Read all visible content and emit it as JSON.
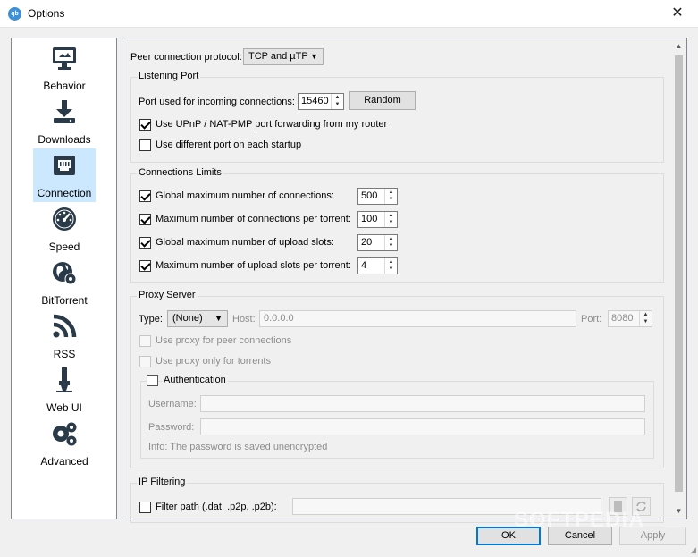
{
  "window": {
    "title": "Options",
    "app_icon": "qb",
    "close": "✕"
  },
  "sidebar": {
    "items": [
      {
        "label": "Behavior",
        "icon": "monitor-icon"
      },
      {
        "label": "Downloads",
        "icon": "download-icon"
      },
      {
        "label": "Connection",
        "icon": "network-icon",
        "selected": true
      },
      {
        "label": "Speed",
        "icon": "speedometer-icon"
      },
      {
        "label": "BitTorrent",
        "icon": "globe-gear-icon"
      },
      {
        "label": "RSS",
        "icon": "rss-icon"
      },
      {
        "label": "Web UI",
        "icon": "plug-icon"
      },
      {
        "label": "Advanced",
        "icon": "gears-icon"
      }
    ]
  },
  "connection": {
    "protocol_label": "Peer connection protocol:",
    "protocol_value": "TCP and µTP",
    "listening": {
      "title": "Listening Port",
      "port_label": "Port used for incoming connections:",
      "port_value": "15460",
      "random_label": "Random",
      "upnp_label": "Use UPnP / NAT-PMP port forwarding from my router",
      "upnp_checked": true,
      "diff_port_label": "Use different port on each startup",
      "diff_port_checked": false
    },
    "limits": {
      "title": "Connections Limits",
      "rows": [
        {
          "label": "Global maximum number of connections:",
          "value": "500",
          "checked": true
        },
        {
          "label": "Maximum number of connections per torrent:",
          "value": "100",
          "checked": true
        },
        {
          "label": "Global maximum number of upload slots:",
          "value": "20",
          "checked": true
        },
        {
          "label": "Maximum number of upload slots per torrent:",
          "value": "4",
          "checked": true
        }
      ]
    },
    "proxy": {
      "title": "Proxy Server",
      "type_label": "Type:",
      "type_value": "(None)",
      "host_label": "Host:",
      "host_value": "0.0.0.0",
      "port_label": "Port:",
      "port_value": "8080",
      "peer_label": "Use proxy for peer connections",
      "torrents_label": "Use proxy only for torrents",
      "auth_label": "Authentication",
      "username_label": "Username:",
      "password_label": "Password:",
      "info": "Info: The password is saved unencrypted"
    },
    "ipfilter": {
      "title": "IP Filtering",
      "path_label": "Filter path (.dat, .p2p, .p2b):"
    }
  },
  "footer": {
    "ok": "OK",
    "cancel": "Cancel",
    "apply": "Apply"
  },
  "watermark": "SOFTPEDIA"
}
